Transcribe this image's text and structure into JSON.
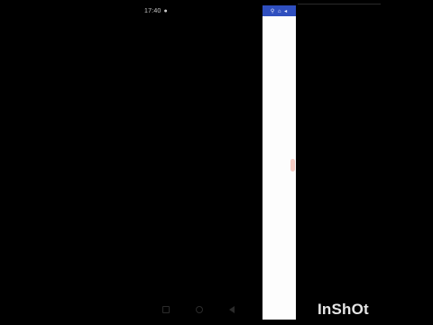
{
  "status_bar": {
    "time": "17:40",
    "indicator_icon": "camera-icon"
  },
  "app": {
    "header_icons": "⚲ ⌂ ◂",
    "scroll_handle_color": "#f4c5bd",
    "header_color": "#2f4fbf"
  },
  "navigation": {
    "icons": [
      "recents-icon",
      "home-icon",
      "back-icon"
    ]
  },
  "watermark": {
    "text": "InShOt"
  }
}
